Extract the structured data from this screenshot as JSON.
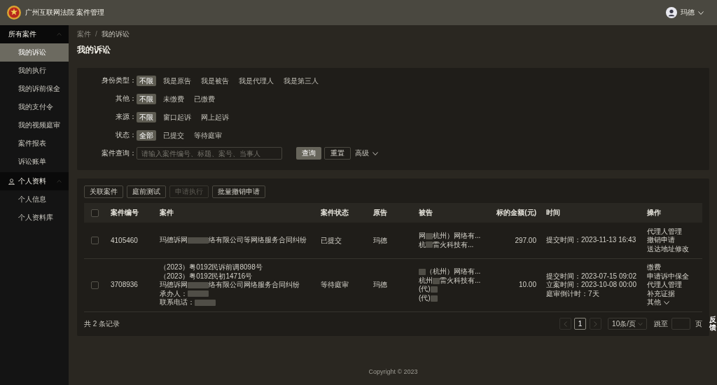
{
  "header": {
    "title": "广州互联网法院 案件管理",
    "user": {
      "name": "玛德"
    }
  },
  "sidebar": {
    "groups": [
      {
        "label": "所有案件",
        "with_icon": false,
        "expanded": true,
        "items": [
          {
            "label": "我的诉讼",
            "selected": true
          },
          {
            "label": "我的执行",
            "selected": false
          },
          {
            "label": "我的诉前保全",
            "selected": false
          },
          {
            "label": "我的支付令",
            "selected": false
          },
          {
            "label": "我的视频庭审",
            "selected": false
          },
          {
            "label": "案件报表",
            "selected": false
          },
          {
            "label": "诉讼账单",
            "selected": false
          }
        ]
      },
      {
        "label": "个人资料",
        "with_icon": true,
        "expanded": true,
        "items": [
          {
            "label": "个人信息",
            "selected": false
          },
          {
            "label": "个人资料库",
            "selected": false
          }
        ]
      }
    ]
  },
  "breadcrumb": {
    "items": [
      "案件",
      "我的诉讼"
    ],
    "separator": "/"
  },
  "page_title": "我的诉讼",
  "filters": [
    {
      "label": "身份类型：",
      "options": [
        {
          "label": "不限",
          "selected": true
        },
        {
          "label": "我是原告",
          "selected": false
        },
        {
          "label": "我是被告",
          "selected": false
        },
        {
          "label": "我是代理人",
          "selected": false
        },
        {
          "label": "我是第三人",
          "selected": false
        }
      ]
    },
    {
      "label": "其他：",
      "options": [
        {
          "label": "不限",
          "selected": true
        },
        {
          "label": "未缴费",
          "selected": false
        },
        {
          "label": "已缴费",
          "selected": false
        }
      ]
    },
    {
      "label": "来源：",
      "options": [
        {
          "label": "不限",
          "selected": true
        },
        {
          "label": "窗口起诉",
          "selected": false
        },
        {
          "label": "网上起诉",
          "selected": false
        }
      ]
    },
    {
      "label": "状态：",
      "options": [
        {
          "label": "全部",
          "selected": true
        },
        {
          "label": "已提交",
          "selected": false
        },
        {
          "label": "等待庭审",
          "selected": false
        }
      ]
    }
  ],
  "search": {
    "label": "案件查询：",
    "placeholder": "请输入案件编号、标题、案号、当事人",
    "buttons": [
      {
        "label": "查询",
        "kind": "primary"
      },
      {
        "label": "重置",
        "kind": "default"
      }
    ],
    "advanced": {
      "label": "高级",
      "expanded": false
    }
  },
  "toolbar": [
    {
      "label": "关联案件",
      "disabled": false
    },
    {
      "label": "庭前测试",
      "disabled": false
    },
    {
      "label": "申请执行",
      "disabled": true
    },
    {
      "label": "批量撤销申请",
      "disabled": false
    }
  ],
  "table": {
    "select_all": {
      "checked": false
    },
    "columns": [
      "案件编号",
      "案件",
      "案件状态",
      "原告",
      "被告",
      "标的金额(元)",
      "时间",
      "操作"
    ],
    "rows": [
      {
        "checked": false,
        "number": "4105460",
        "case": [
          [
            {
              "kind": "text",
              "text": "玛德诉网"
            },
            {
              "kind": "redacted"
            },
            {
              "kind": "text",
              "text": "络有限公司等网络服务合同纠纷"
            }
          ]
        ],
        "status": "已提交",
        "plaintiff": "玛德",
        "defendants": [
          [
            {
              "kind": "text",
              "text": "网"
            },
            {
              "kind": "redacted"
            },
            {
              "kind": "text",
              "text": "杭州）网络有..."
            }
          ],
          [
            {
              "kind": "text",
              "text": "杭"
            },
            {
              "kind": "redacted"
            },
            {
              "kind": "text",
              "text": "雷火科技有..."
            }
          ]
        ],
        "amount": "297.00",
        "times": [
          "提交时间：2023-11-13 16:43"
        ],
        "actions": [
          {
            "label": "代理人管理",
            "kind": "link"
          },
          {
            "label": "撤销申请",
            "kind": "link"
          },
          {
            "label": "送达地址修改",
            "kind": "link"
          }
        ]
      },
      {
        "checked": false,
        "number": "3708936",
        "case": [
          [
            {
              "kind": "text",
              "text": "（2023）粤0192民诉前调8098号"
            }
          ],
          [
            {
              "kind": "text",
              "text": "（2023）粤0192民初14716号"
            }
          ],
          [
            {
              "kind": "text",
              "text": "玛德诉网"
            },
            {
              "kind": "redacted"
            },
            {
              "kind": "text",
              "text": "络有限公司网络服务合同纠纷"
            }
          ],
          [
            {
              "kind": "text",
              "text": "承办人："
            },
            {
              "kind": "redacted"
            }
          ],
          [
            {
              "kind": "text",
              "text": "联系电话："
            },
            {
              "kind": "redacted"
            }
          ]
        ],
        "status": "等待庭审",
        "plaintiff": "玛德",
        "defendants": [
          [
            {
              "kind": "redacted"
            },
            {
              "kind": "text",
              "text": "（杭州）网络有..."
            }
          ],
          [
            {
              "kind": "text",
              "text": "杭州"
            },
            {
              "kind": "redacted"
            },
            {
              "kind": "text",
              "text": "雷火科技有..."
            }
          ],
          [
            {
              "kind": "text",
              "text": "(代)"
            },
            {
              "kind": "redacted"
            }
          ],
          [
            {
              "kind": "text",
              "text": "(代)"
            },
            {
              "kind": "redacted"
            }
          ]
        ],
        "amount": "10.00",
        "times": [
          "提交时间：2023-07-15 09:02",
          "立案时间：2023-10-08 00:00",
          "庭审倒计时：7天"
        ],
        "actions": [
          {
            "label": "缴费",
            "kind": "link"
          },
          {
            "label": "申请诉中保全",
            "kind": "link"
          },
          {
            "label": "代理人管理",
            "kind": "link"
          },
          {
            "label": "补充证据",
            "kind": "link"
          },
          {
            "label": "其他",
            "kind": "dropdown"
          }
        ]
      }
    ]
  },
  "footer": {
    "total": "共 2 条记录",
    "pagination": {
      "prev": {
        "disabled": true
      },
      "pages": [
        {
          "label": "1",
          "selected": true
        }
      ],
      "next": {
        "disabled": true
      },
      "page_size": "10条/页",
      "jump_label": "跳至",
      "jump_suffix": "页"
    }
  },
  "feedback": "反馈",
  "copyright": "Copyright © 2023"
}
